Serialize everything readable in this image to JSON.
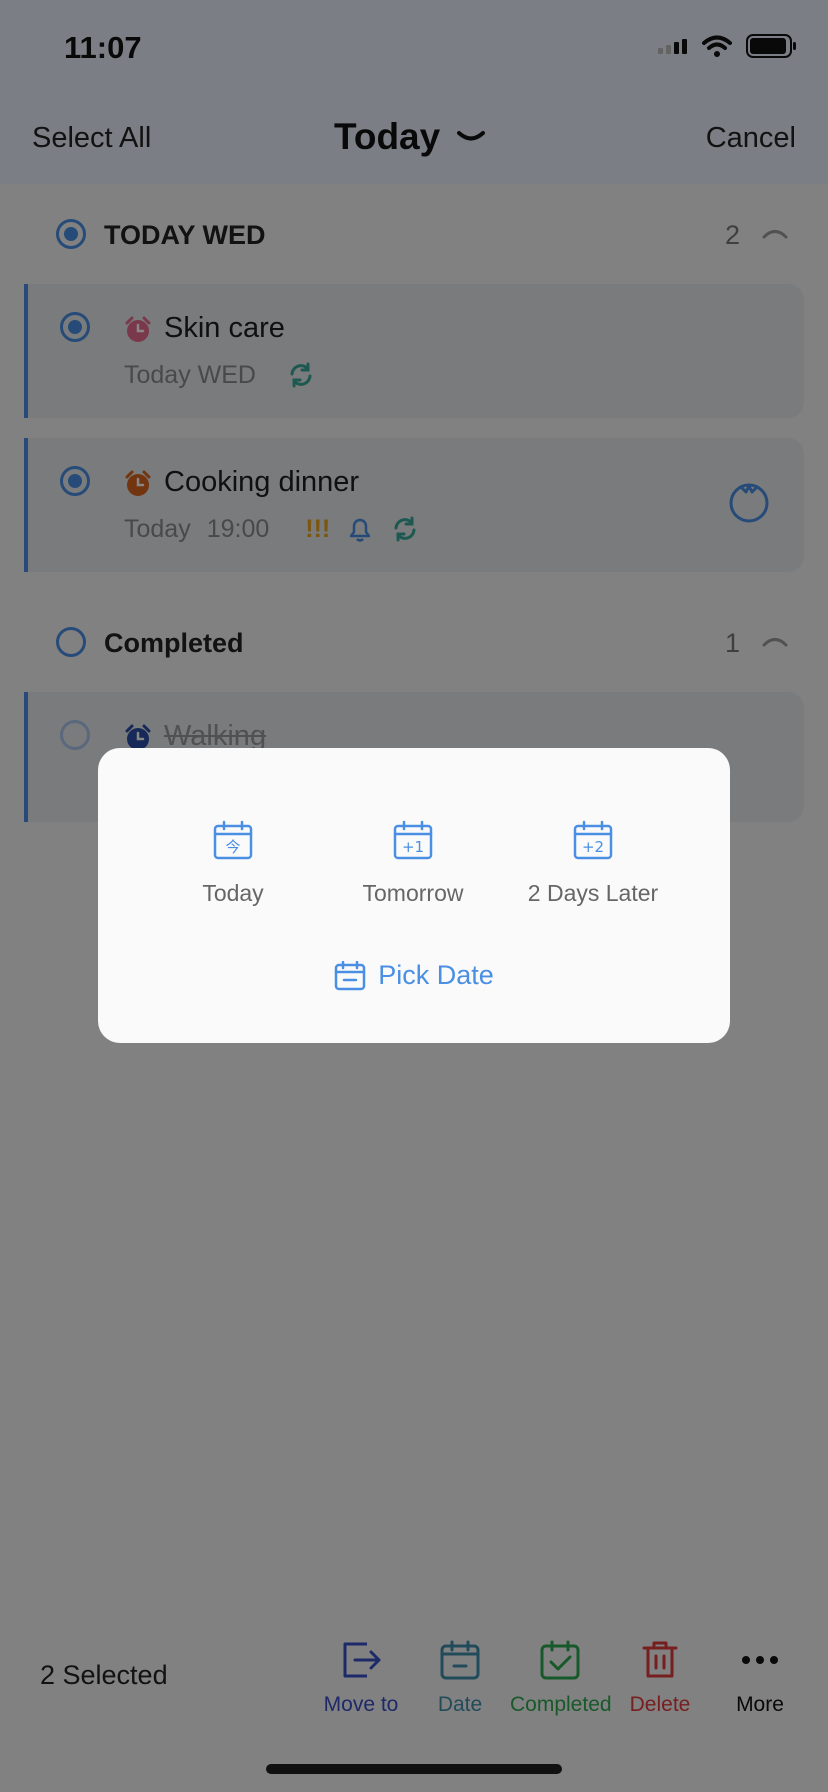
{
  "status": {
    "time": "11:07"
  },
  "nav": {
    "select_all": "Select All",
    "title": "Today",
    "cancel": "Cancel"
  },
  "sections": {
    "today": {
      "title": "TODAY WED",
      "count": "2"
    },
    "completed": {
      "title": "Completed",
      "count": "1"
    }
  },
  "tasks": [
    {
      "title": "Skin care",
      "date": "Today WED",
      "clock_color": "#e66c8c",
      "checked": true
    },
    {
      "title": "Cooking dinner",
      "date": "Today",
      "time": "19:00",
      "priority": "!!!",
      "clock_color": "#d8651e",
      "checked": true
    },
    {
      "title": "Walking",
      "clock_color": "#2b4fa8",
      "checked": false,
      "completed": true
    }
  ],
  "modal": {
    "options": [
      {
        "label": "Today",
        "icon": "calendar-today-icon",
        "glyph": "今"
      },
      {
        "label": "Tomorrow",
        "icon": "calendar-plus1-icon",
        "glyph": "+1"
      },
      {
        "label": "2 Days Later",
        "icon": "calendar-plus2-icon",
        "glyph": "+2"
      }
    ],
    "pick_date": "Pick Date"
  },
  "bottom": {
    "selected": "2 Selected",
    "actions": [
      {
        "label": "Move to",
        "color": "#3a4fc4",
        "icon": "move-to-icon"
      },
      {
        "label": "Date",
        "color": "#3f8fa8",
        "icon": "date-icon"
      },
      {
        "label": "Completed",
        "color": "#2fa84f",
        "icon": "completed-icon"
      },
      {
        "label": "Delete",
        "color": "#e03c3c",
        "icon": "delete-icon"
      },
      {
        "label": "More",
        "color": "#111111",
        "icon": "more-icon"
      }
    ]
  },
  "colors": {
    "accent": "#4a8fe3",
    "pomodoro": "#4a8fe3"
  }
}
